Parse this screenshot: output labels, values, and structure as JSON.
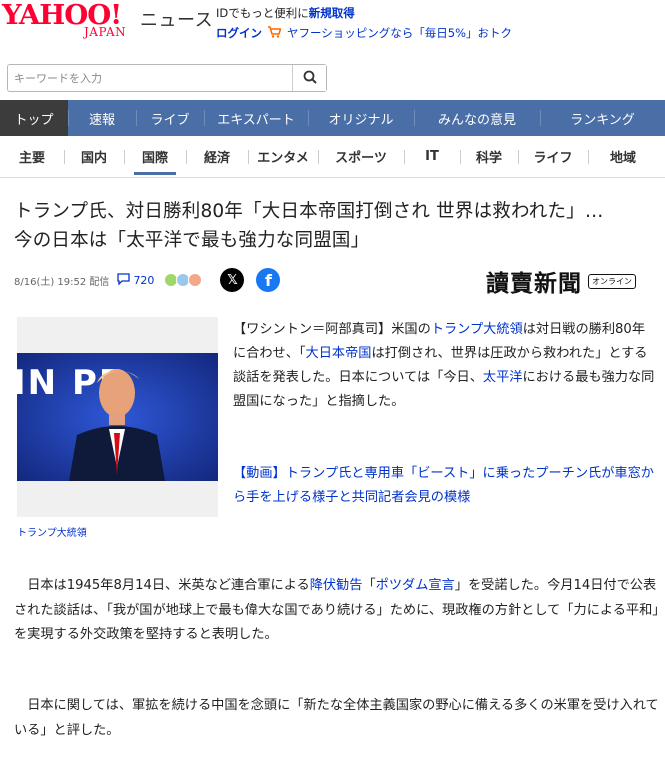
{
  "header": {
    "logo_main": "YAHOO!",
    "logo_sub": "JAPAN",
    "brand": "ニュース",
    "promo_prefix": "IDでもっと便利に",
    "promo_link": "新規取得",
    "login": "ログイン",
    "shopping": "ヤフーショッピングなら「毎日5%」おトク"
  },
  "search": {
    "placeholder": "キーワードを入力"
  },
  "nav_primary": [
    {
      "label": "トップ"
    },
    {
      "label": "速報"
    },
    {
      "label": "ライブ"
    },
    {
      "label": "エキスパート"
    },
    {
      "label": "オリジナル"
    },
    {
      "label": "みんなの意見"
    },
    {
      "label": "ランキング"
    }
  ],
  "nav_secondary": [
    {
      "label": "主要"
    },
    {
      "label": "国内"
    },
    {
      "label": "国際"
    },
    {
      "label": "経済"
    },
    {
      "label": "エンタメ"
    },
    {
      "label": "スポーツ"
    },
    {
      "label": "IT"
    },
    {
      "label": "科学"
    },
    {
      "label": "ライフ"
    },
    {
      "label": "地域"
    }
  ],
  "article": {
    "title_line1": "トランプ氏、対日勝利80年「大日本帝国打倒され 世界は救われた」…",
    "title_line2": "今の日本は「太平洋で最も強力な同盟国」",
    "date": "8/16(土) 19:52 配信",
    "comment_count": "720",
    "publisher": "讀賣新聞",
    "publisher_tag": "オンライン",
    "photo_caption": "トランプ大統領",
    "photo_sign_text": "IN PE",
    "lead": {
      "t1": "【ワシントン＝阿部真司】米国の",
      "l1": "トランプ大統領",
      "t2": "は対日戦の勝利80年に合わせ、「",
      "l2": "大日本帝国",
      "t3": "は打倒され、世界は圧政から救われた」とする談話を発表した。日本については「今日、",
      "l3": "太平洋",
      "t4": "における最も強力な同盟国になった」と指摘した。"
    },
    "video_link": "【動画】トランプ氏と専用車「ビースト」に乗ったプーチン氏が車窓から手を上げる様子と共同記者会見の模様",
    "para1": {
      "t1": "日本は1945年8月14日、米英など連合軍による",
      "l1": "降伏勧告",
      "t2": "「",
      "l2": "ポツダム宣言",
      "t3": "」を受諾した。今月14日付で公表された談話は、「我が国が地球上で最も偉大な国であり続ける」ために、現政権の方針として「力による平和」を実現する外交政策を堅持すると表明した。"
    },
    "para2": "日本に関しては、軍拡を続ける中国を念頭に「新たな全体主義国家の野心に備える多くの米軍を受け入れている」と評した。"
  },
  "colors": {
    "nav_primary_bg": "#4a6ea6",
    "nav_active_bg": "#3c3c3c",
    "link": "#0033cc",
    "logo": "#ff0033"
  }
}
